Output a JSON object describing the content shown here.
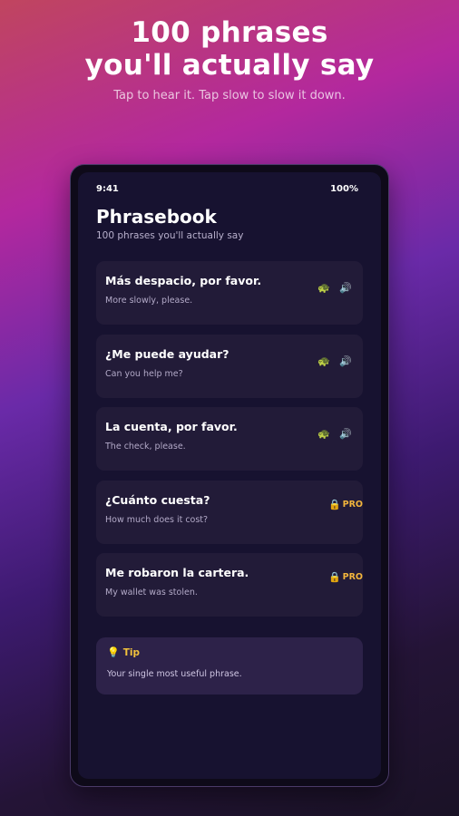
{
  "hero": {
    "title_line1": "100 phrases",
    "title_line2": "you'll actually say",
    "subtitle": "Tap to hear it. Tap slow to slow it down."
  },
  "status_bar": {
    "time": "9:41",
    "battery": "100%"
  },
  "app": {
    "title": "Phrasebook",
    "subtitle": "100 phrases you'll actually say"
  },
  "phrases": [
    {
      "phrase": "Más despacio, por favor.",
      "translation": "More slowly, please.",
      "locked": false
    },
    {
      "phrase": "¿Me puede ayudar?",
      "translation": "Can you help me?",
      "locked": false
    },
    {
      "phrase": "La cuenta, por favor.",
      "translation": "The check, please.",
      "locked": false
    },
    {
      "phrase": "¿Cuánto cuesta?",
      "translation": "How much does it cost?",
      "locked": true,
      "badge": "PRO"
    },
    {
      "phrase": "Me robaron la cartera.",
      "translation": "My wallet was stolen.",
      "locked": true,
      "badge": "PRO"
    }
  ],
  "icons": {
    "slow": "turtle-icon",
    "play": "speaker-icon",
    "lock": "lock-icon",
    "tip": "lightbulb-icon"
  },
  "tip": {
    "label": "Tip",
    "body": "Your single most useful phrase."
  },
  "colors": {
    "accent_gold": "#f2b53c",
    "card_bg": "#221b38",
    "screen_bg": "#171230",
    "tip_bg": "#2d2249"
  }
}
